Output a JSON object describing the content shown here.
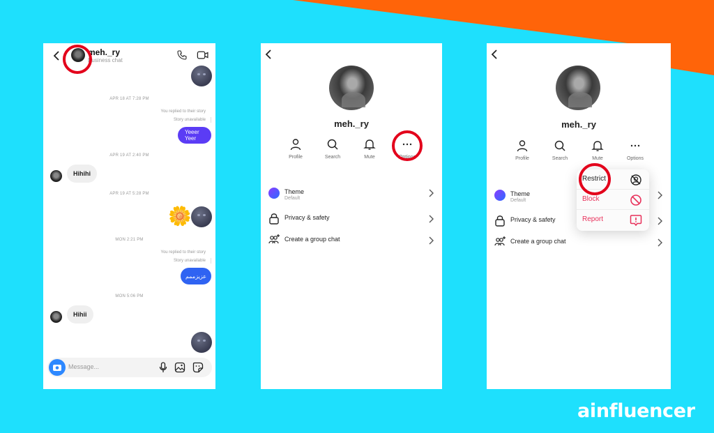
{
  "colors": {
    "background": "#1ee0fd",
    "accent_orange": "#ff6409",
    "highlight_ring": "#e3001b",
    "bubble_purple": "#5b3cf5",
    "bubble_blue": "#2f63f2",
    "danger": "#e8305a"
  },
  "chat_panel": {
    "header": {
      "username": "meh._ry",
      "subtitle": "Business chat",
      "icons": [
        "back-icon",
        "phone-icon",
        "video-camera-icon"
      ]
    },
    "messages": [
      {
        "type": "emoji",
        "direction": "out",
        "content": "new-moon-face"
      },
      {
        "type": "timestamp",
        "text": "APR 18 AT 7:28 PM"
      },
      {
        "type": "story_reply_note",
        "text": "You replied to their story",
        "sub": "Story unavailable"
      },
      {
        "type": "text",
        "direction": "out",
        "text": "Yeeer Yeer"
      },
      {
        "type": "timestamp",
        "text": "APR 19 AT 2:40 PM"
      },
      {
        "type": "text",
        "direction": "in",
        "text": "Hihihi"
      },
      {
        "type": "timestamp",
        "text": "APR 19 AT 5:28 PM"
      },
      {
        "type": "emoji",
        "direction": "out",
        "content": "sunflower + new-moon-face"
      },
      {
        "type": "timestamp",
        "text": "MON 2:21 PM"
      },
      {
        "type": "story_reply_note",
        "text": "You replied to their story",
        "sub": "Story unavailable"
      },
      {
        "type": "text",
        "direction": "out",
        "text": "عزیزممم"
      },
      {
        "type": "timestamp",
        "text": "MON 5:06 PM"
      },
      {
        "type": "text",
        "direction": "in",
        "text": "Hihii"
      },
      {
        "type": "emoji",
        "direction": "out",
        "content": "new-moon-face"
      }
    ],
    "composer": {
      "placeholder": "Message...",
      "icons": [
        "camera-icon",
        "microphone-icon",
        "gallery-icon",
        "sticker-icon"
      ]
    }
  },
  "profile_panel": {
    "username": "meh._ry",
    "actions": [
      {
        "label": "Profile",
        "icon": "person-icon"
      },
      {
        "label": "Search",
        "icon": "search-icon"
      },
      {
        "label": "Mute",
        "icon": "bell-icon"
      },
      {
        "label": "Options",
        "icon": "more-dots-icon"
      }
    ],
    "settings": [
      {
        "label": "Theme",
        "sub": "Default",
        "icon": "theme-dot"
      },
      {
        "label": "Privacy & safety",
        "icon": "lock-icon"
      },
      {
        "label": "Create a group chat",
        "icon": "add-group-icon"
      }
    ]
  },
  "options_menu": {
    "items": [
      {
        "label": "Restrict",
        "icon": "restrict-icon"
      },
      {
        "label": "Block",
        "icon": "block-icon"
      },
      {
        "label": "Report",
        "icon": "report-icon"
      }
    ]
  },
  "brand": {
    "logo_text": "ainfluencer"
  }
}
